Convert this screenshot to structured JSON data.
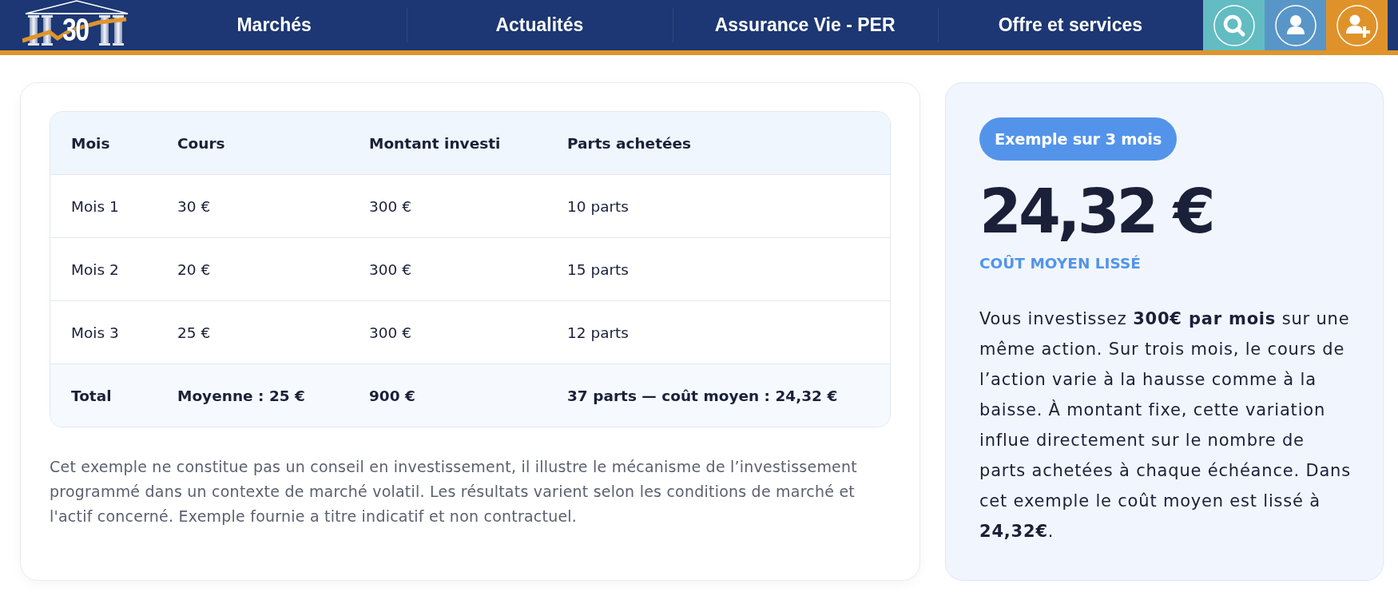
{
  "header": {
    "logo_text": "30",
    "nav": [
      {
        "label": "Marchés"
      },
      {
        "label": "Actualités"
      },
      {
        "label": "Assurance Vie - PER"
      },
      {
        "label": "Offre et services"
      }
    ]
  },
  "table": {
    "columns": [
      "Mois",
      "Cours",
      "Montant investi",
      "Parts achetées"
    ],
    "rows": [
      [
        "Mois 1",
        "30 €",
        "300 €",
        "10 parts"
      ],
      [
        "Mois 2",
        "20 €",
        "300 €",
        "15 parts"
      ],
      [
        "Mois 3",
        "25 €",
        "300 €",
        "12 parts"
      ]
    ],
    "total": [
      "Total",
      "Moyenne : 25 €",
      "900 €",
      "37 parts — coût moyen : 24,32 €"
    ]
  },
  "disclaimer": "Cet exemple ne constitue pas un conseil en investissement, il illustre le mécanisme de l’investissement programmé dans un contexte de marché volatil. Les résultats varient selon les conditions de marché et l'actif concerné. Exemple fournie a titre indicatif et non contractuel.",
  "summary": {
    "badge": "Exemple sur 3 mois",
    "value": "24,32 €",
    "label": "COÛT MOYEN LISSÉ",
    "text": "Vous investissez **300€ par mois** sur une même action. Sur trois mois, le cours de l’action varie à la hausse comme à la baisse. À montant fixe, cette variation influe directement sur le nombre de parts achetées à chaque échéance. Dans cet exemple le coût moyen est lissé à **24,32€**."
  }
}
